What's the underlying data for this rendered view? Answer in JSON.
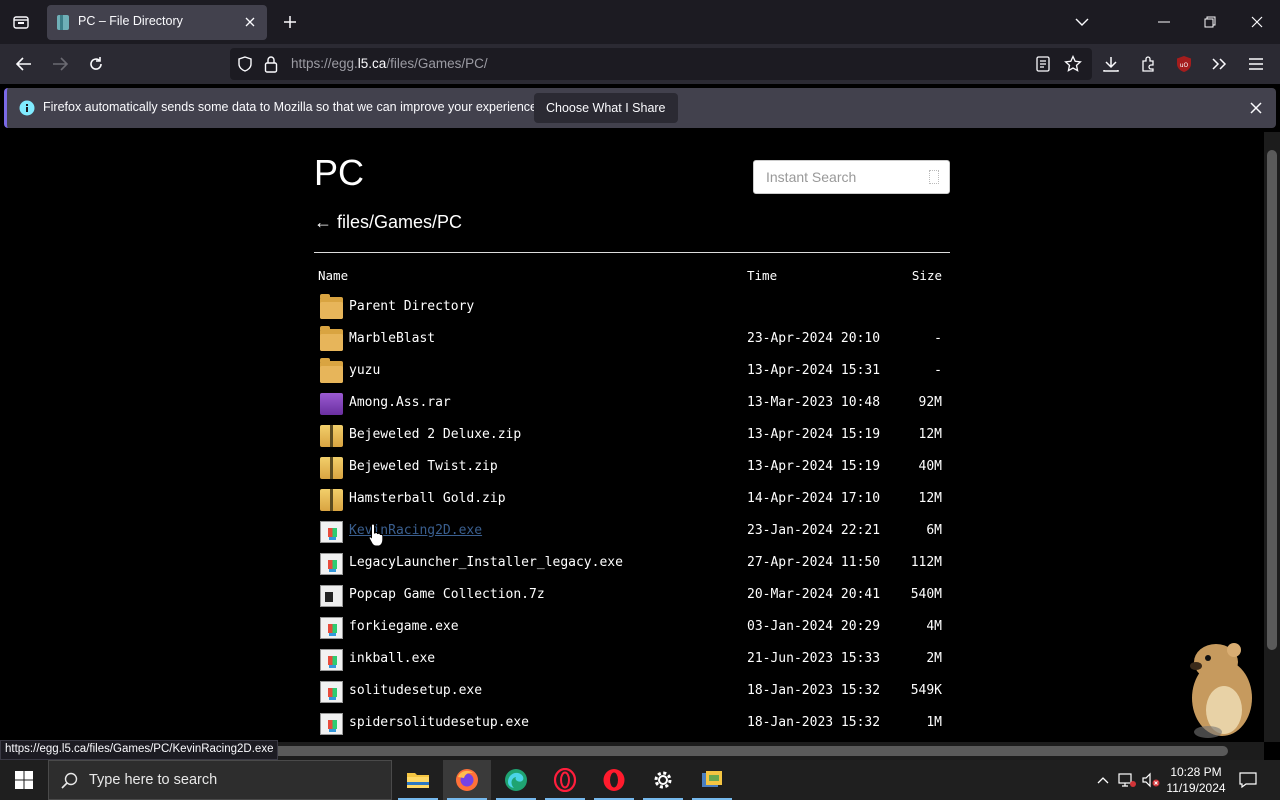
{
  "browser": {
    "tab": {
      "title": "PC – File Directory"
    },
    "url": {
      "prefix": "https://egg.",
      "domain": "l5.ca",
      "path": "/files/Games/PC/"
    }
  },
  "notification": {
    "text": "Firefox automatically sends some data to Mozilla so that we can improve your experience.",
    "button": "Choose What I Share"
  },
  "page": {
    "title": "PC",
    "search_placeholder": "Instant Search",
    "breadcrumb": "← files/Games/PC",
    "columns": {
      "name": "Name",
      "time": "Time",
      "size": "Size"
    },
    "rows": [
      {
        "name": "Parent Directory",
        "time": "",
        "size": "",
        "type": "folder"
      },
      {
        "name": "MarbleBlast",
        "time": "23-Apr-2024 20:10",
        "size": "-",
        "type": "folder"
      },
      {
        "name": "yuzu",
        "time": "13-Apr-2024 15:31",
        "size": "-",
        "type": "folder"
      },
      {
        "name": "Among.Ass.rar",
        "time": "13-Mar-2023 10:48",
        "size": "92M",
        "type": "rar"
      },
      {
        "name": "Bejeweled 2 Deluxe.zip",
        "time": "13-Apr-2024 15:19",
        "size": "12M",
        "type": "zip"
      },
      {
        "name": "Bejeweled Twist.zip",
        "time": "13-Apr-2024 15:19",
        "size": "40M",
        "type": "zip"
      },
      {
        "name": "Hamsterball Gold.zip",
        "time": "14-Apr-2024 17:10",
        "size": "12M",
        "type": "zip"
      },
      {
        "name": "KevinRacing2D.exe",
        "time": "23-Jan-2024 22:21",
        "size": "6M",
        "type": "exe"
      },
      {
        "name": "LegacyLauncher_Installer_legacy.exe",
        "time": "27-Apr-2024 11:50",
        "size": "112M",
        "type": "exe"
      },
      {
        "name": "Popcap Game Collection.7z",
        "time": "20-Mar-2024 20:41",
        "size": "540M",
        "type": "7z"
      },
      {
        "name": "forkiegame.exe",
        "time": "03-Jan-2024 20:29",
        "size": "4M",
        "type": "exe"
      },
      {
        "name": "inkball.exe",
        "time": "21-Jun-2023 15:33",
        "size": "2M",
        "type": "exe"
      },
      {
        "name": "solitudesetup.exe",
        "time": "18-Jan-2023 15:32",
        "size": "549K",
        "type": "exe"
      },
      {
        "name": "spidersolitudesetup.exe",
        "time": "18-Jan-2023 15:32",
        "size": "1M",
        "type": "exe"
      }
    ]
  },
  "status_url": "https://egg.l5.ca/files/Games/PC/KevinRacing2D.exe",
  "taskbar": {
    "search_text": "Type here to search",
    "time": "10:28 PM",
    "date": "11/19/2024"
  }
}
